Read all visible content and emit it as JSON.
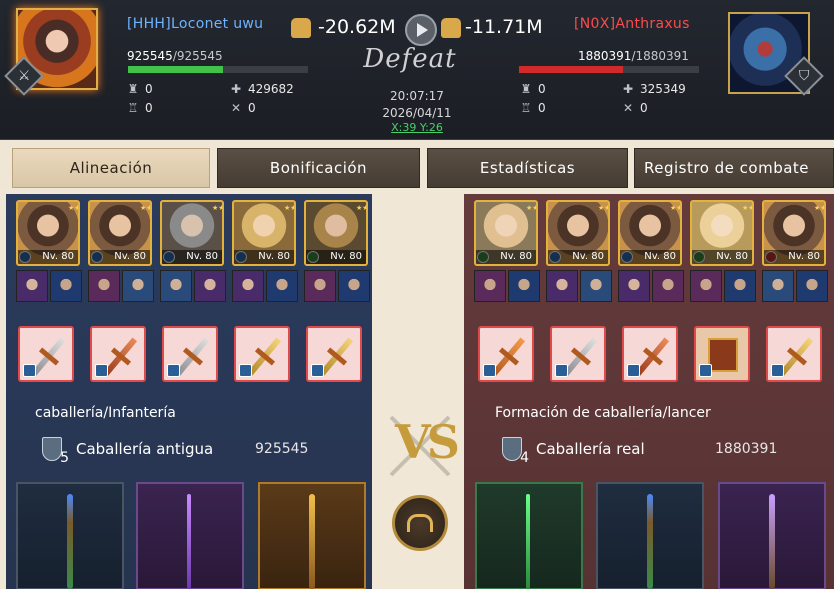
{
  "battle": {
    "result": "Defeat",
    "time": "20:07:17",
    "date": "2026/04/11",
    "coords": "X:39 Y:26",
    "left_power": "-20.62M",
    "right_power": "-11.71M"
  },
  "left_player": {
    "name": "[HHH]Loconet uwu",
    "name_color": "#6fb3ff",
    "hp_current": "925545",
    "hp_max": "/925545",
    "hp_fraction": 0.53,
    "stats": {
      "a": "0",
      "b": "429682",
      "c": "0",
      "d": "0"
    }
  },
  "right_player": {
    "name": "[N0X]Anthraxus",
    "name_color": "#ff4a4a",
    "hp_current": "1880391",
    "hp_max": "/1880391",
    "hp_fraction": 0.58,
    "stats": {
      "a": "0",
      "b": "325349",
      "c": "0",
      "d": "0"
    }
  },
  "tabs": [
    "Alineación",
    "Bonificación",
    "Estadísticas",
    "Registro de combate"
  ],
  "left_lineup": {
    "hero_level": "Nv. 80",
    "formation": "caballería/Infantería",
    "troop_tier": "5",
    "troop_name": "Caballería antigua",
    "troop_count": "925545"
  },
  "right_lineup": {
    "hero_level": "Nv. 80",
    "formation": "Formación de caballería/lancer",
    "troop_tier": "4",
    "troop_name": "Caballería real",
    "troop_count": "1880391"
  },
  "vs_label": "VS",
  "icons": {
    "fist": "fist-icon",
    "play": "play-icon",
    "book": "codex-icon",
    "rank_left": "sword-rank-icon",
    "rank_right": "shield-rank-icon"
  }
}
